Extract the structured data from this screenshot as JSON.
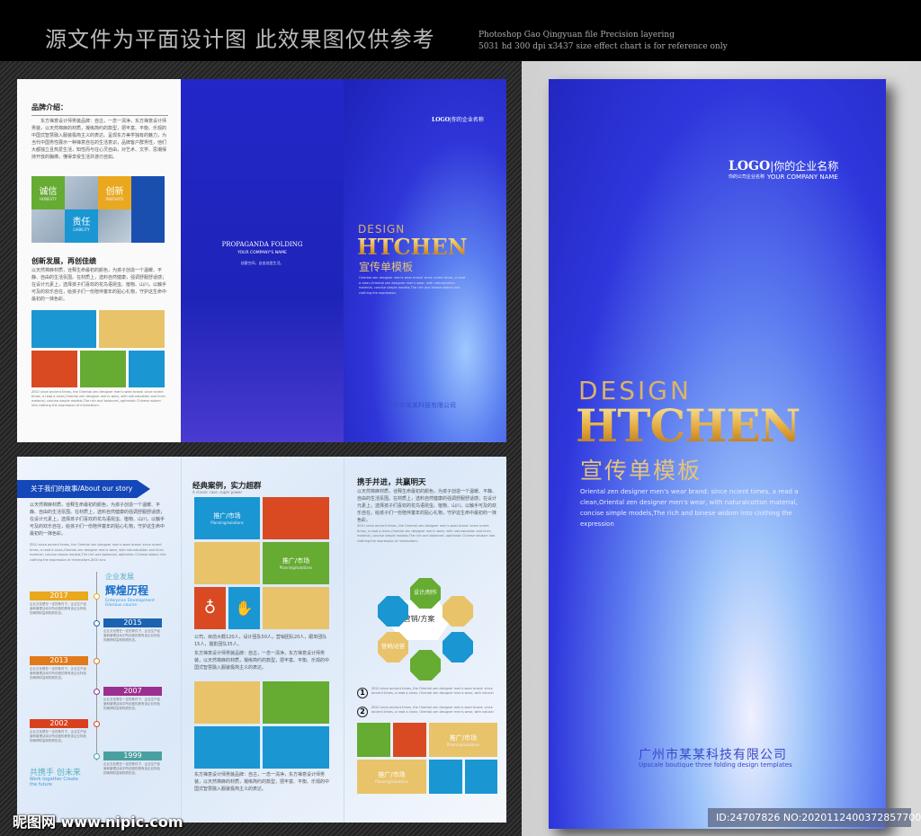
{
  "header": {
    "title_cn": "源文件为平面设计图 此效果图仅供参考",
    "note_line1": "Photoshop Gao Qingyuan file Precision layering",
    "note_line2": "5031 hd 300 dpi x3437 size effect chart is for reference only"
  },
  "inside_top": {
    "brand_title": "品牌介绍：",
    "brand_text": "东方禅意设计师男装品牌：自古，一念一清净，东方禅意设计师男装，以天然棉麻的材质，凝练简约的款型，把丰富、平衡、乐观的中国式智慧融入服装极简主义的表达。呈现东方美学独有的魅力，为当代中国男性展示一种禅意自在的生活意识，品牌客户群男性，他们大都独立且热爱生活，知性而与往心灵自由，对艺术、文学、思潮保持开放的胸襟，懂得享受生活并游刃自如。",
    "tiles": [
      {
        "cn": "诚信",
        "en": "HONESTY"
      },
      {
        "cn": "创新",
        "en": "INNOVATE"
      },
      {
        "cn": "责任",
        "en": "LIABILITY"
      }
    ],
    "innov_title": "创新发展，再创佳绩",
    "innov_text": "以天然棉麻材质，诠释生命最初的颜色，为孩子创造一个温暖、平静、自由的生活氛围。在材质上，选料自然健康，强调舒服舒适感；在设计元素上，选择孩子们喜欢的花鸟语昆虫、植物、山川，以触手可及的欢乐自在，给孩子们一份陪伴童年的贴心礼物，守护这生命中最初的一抹色彩。",
    "innov_en": "ZIGU since ancient times, the Oriental zen designer men's wear brand: since ncient times, a read a clean,Oriental zen designer men's wear, with naturalcotton and linen material, concise simple models,The rich and balanced, optimistic Chinese widom into clothing the expression of minimalism.",
    "back_title": "PROPAGANDA FOLDING",
    "back_company": "YOUR COMPANY'S NAME",
    "back_tag": "创意空间，自由创造生活。",
    "front_logo": "LOGO",
    "front_company_cn": "你的企业名称",
    "front_design": "DESIGN",
    "front_brand": "HTCHEN",
    "front_sub": "宣传单模板",
    "front_text": "Oriental zen designer men's wear brand: since ncient times, a read a clean,Oriental zen designer men's wear, with naturalcotton material, concise simple models,The rich and binese widom into clothing the expression.",
    "front_company": "广州市某某科技有限公司"
  },
  "inside_bottom": {
    "story_banner": "关于我们的故事/About our story",
    "story_text": "以天然棉麻材质，诠释生命最初的颜色，为孩子创造一个温暖、平静、自由的生活氛围。在材质上，选料自然健康的强调舒服舒适感；在设计元素上，选择孩子们喜欢的花鸟语昆虫、植物、山川，以触手可及的欢乐自在，给孩子们一份陪伴童年的贴心礼物，守护这生命中最初的一抹色彩。",
    "story_en": "ZIGU since ancient times, the Oriental zen designer men's wear brand: since ncient times, a read a clean,Oriental zen designer men's wear, with naturalcotton and linen material, concise simple models,The rich and balanced, optimistic Chinese widom into clothing the expression of minimalism.ZIGU sinc",
    "history_small": "企业发展",
    "history_big": "辉煌历程",
    "history_en": "Enterprise Development Glorious course",
    "timeline": [
      {
        "year": "2017",
        "color": "#eaa81f",
        "text": "企业文化是在一定的条件下，企业生产经营和管理活动中所创造的具有该企业特色的精神财富和物质形态。"
      },
      {
        "year": "2015",
        "color": "#1b63b0",
        "text": "企业文化是在一定的条件下，企业生产经营和管理活动中所创造的具有该企业特色的精神财富和物质形态。"
      },
      {
        "year": "2013",
        "color": "#e07a1a",
        "text": "企业文化是在一定的条件下，企业生产经营和管理活动中所创造的具有该企业特色的精神财富和物质形态。"
      },
      {
        "year": "2007",
        "color": "#9b3090",
        "text": "企业文化是在一定的条件下，企业生产经营和管理活动中所创造的具有该企业特色的精神财富和物质形态。"
      },
      {
        "year": "2002",
        "color": "#d9411e",
        "text": "企业文化是在一定的条件下，企业生产经营和管理活动中所创造的具有该企业特色的精神财富和物质形态。"
      },
      {
        "year": "1999",
        "color": "#4aa0a0",
        "text": "企业文化是在一定的条件下，企业生产经营和管理活动中所创造的具有该企业特色的精神财富和物质形态。"
      }
    ],
    "together_cn": "共携手 创未来",
    "together_en": "Work together Create the future",
    "cases_title": "经典案例，实力超群",
    "cases_sub": "A classic case, super power",
    "tile_label": "推广/市场",
    "tile_sub": "Planning/solutions",
    "cases_text1": "公司，目前大概120人，设计团队50人，营销团队20人，跟单团队15人，摄影团队35人。",
    "cases_text2": "东方禅意设计师男装品牌：自古，一念一清净，东方禅意设计师男装，以天然棉麻的材质，凝练简约的款型，把丰富、平衡、乐观的中国式智慧融入服装极简主义的表达。",
    "cases_text3": "东方禅意设计师男装品牌：自古，一念一清净，东方禅意设计师男装，以天然棉麻的材质，凝练简约的款型，把丰富、平衡、乐观的中国式智慧融入服装极简主义的表达。",
    "win_title": "携手并进，共赢明天",
    "win_text": "以天然棉麻材质，诠释生命最初的颜色，为孩子创造一个温暖、平静、自由的生活氛围。在材质上，选料自然健康的强调舒服舒适感；在设计元素上，选择孩子们喜欢的花鸟语昆虫、植物、山川，以触手可及的欢乐自在，给孩子们一份陪伴童年的贴心礼物，守护这生命中最初的一抹色彩。",
    "win_en": "ZIGU since ancient times, the Oriental zen designer men's wear brand: since ncient times, a read a clean,Oriental zen designer men's wear, with naturalcotton and linen material, concise simple models,The rich and balanced, optimistic Chinese wisdom into clothing the expression of minimalism.",
    "hub_center": "营销/方案",
    "hub_design": "设计/制作",
    "hub_ops": "营销/运营",
    "point1": "ZIGU since ancient times, the Oriental zen designer men's wear brand: since ancient times, a read a clean, Oriental zen designer men's wear, with natural",
    "point2": "ZIGU since ancient times, the Oriental zen designer men's wear brand: since ancient times, a read a clean, Oriental zen designer men's wear, with natural",
    "num1": "1",
    "num2": "2"
  },
  "cover": {
    "logo": "LOGO",
    "logo_sub": "你的公司企业名称",
    "company_cn": "你的企业名称",
    "company_en": "YOUR COMPANY NAME",
    "design": "DESIGN",
    "brand": "HTCHEN",
    "subtitle": "宣传单模板",
    "text": "Oriental zen designer men's wear brand: since ncient times, a read a clean,Oriental zen designer men's wear, with naturalcotton material, concise simple models,The rich and binese widom into clothing the expression",
    "company": "广州市某某科技有限公司",
    "tagline": "Upscale boutique three folding design templates"
  },
  "watermark": {
    "site": "昵图网 www.nipic.com",
    "id": "ID:24707826 NO:20201124003728577000"
  }
}
